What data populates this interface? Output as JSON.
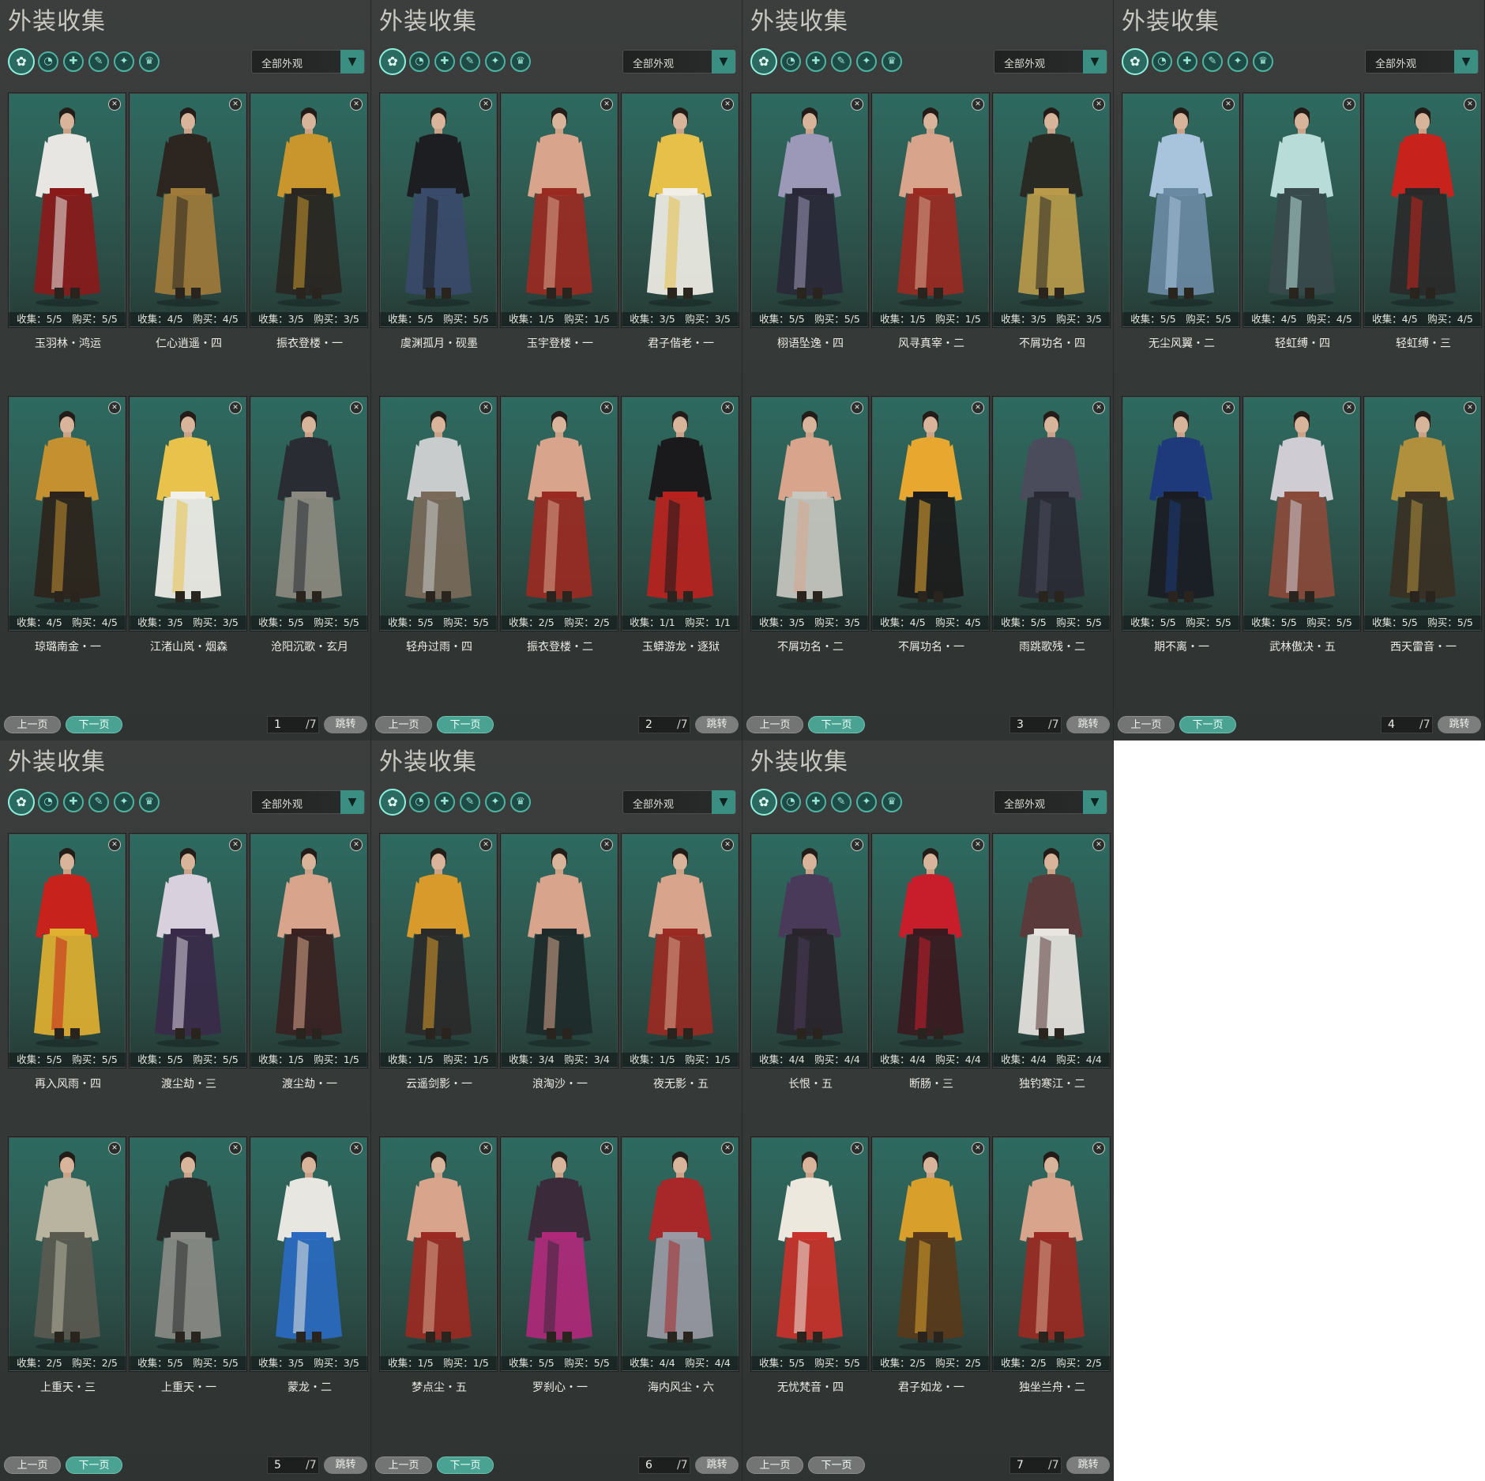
{
  "panel_title": "外装收集",
  "dropdown_label": "全部外观",
  "prev_label": "上一页",
  "next_label": "下一页",
  "jump_label": "跳转",
  "filter_icons": [
    "all-outfits-icon",
    "hair-icon",
    "top-icon",
    "dye-icon",
    "mask-icon",
    "hat-icon"
  ],
  "panels": [
    {
      "page": "1",
      "total": "/7",
      "items": [
        {
          "name": "玉羽林・鸿运",
          "stats": "收集：5/5　购买：5/5",
          "colors": [
            "#e8e6e2",
            "#8a1a1a"
          ]
        },
        {
          "name": "仁心逍遥・四",
          "stats": "收集：4/5　购买：4/5",
          "colors": [
            "#2d2620",
            "#a07a3a"
          ]
        },
        {
          "name": "振衣登楼・一",
          "stats": "收集：3/5　购买：3/5",
          "colors": [
            "#c8962c",
            "#2a2622"
          ]
        },
        {
          "name": "琼璐南金・一",
          "stats": "收集：4/5　购买：4/5",
          "colors": [
            "#c49030",
            "#2c241c"
          ]
        },
        {
          "name": "江渚山岚・烟森",
          "stats": "收集：3/5　购买：3/5",
          "colors": [
            "#e8c24a",
            "#f2f0ea"
          ]
        },
        {
          "name": "沧阳沉歌・玄月",
          "stats": "收集：5/5　购买：5/5",
          "colors": [
            "#2a2c34",
            "#8c8a80"
          ]
        }
      ]
    },
    {
      "page": "2",
      "total": "/7",
      "items": [
        {
          "name": "虞渊孤月・砚墨",
          "stats": "收集：5/5　购买：5/5",
          "colors": [
            "#1c1e22",
            "#3a4a6a"
          ]
        },
        {
          "name": "玉宇登楼・一",
          "stats": "收集：1/5　购买：1/5",
          "colors": [
            "#d8a58c",
            "#9a2a22"
          ]
        },
        {
          "name": "君子偕老・一",
          "stats": "收集：3/5　购买：3/5",
          "colors": [
            "#e6c048",
            "#f0eee6"
          ]
        },
        {
          "name": "轻舟过雨・四",
          "stats": "收集：5/5　购买：5/5",
          "colors": [
            "#c8cccc",
            "#7a6a5a"
          ]
        },
        {
          "name": "振衣登楼・二",
          "stats": "收集：2/5　购买：2/5",
          "colors": [
            "#d8a58c",
            "#9a2a22"
          ]
        },
        {
          "name": "玉蟒游龙・逐狱",
          "stats": "收集：1/1　购买：1/1",
          "colors": [
            "#1a1a1c",
            "#b8221e"
          ]
        }
      ]
    },
    {
      "page": "3",
      "total": "/7",
      "items": [
        {
          "name": "栩语坠逸・四",
          "stats": "收集：5/5　购买：5/5",
          "colors": [
            "#9c98b8",
            "#2a2838"
          ]
        },
        {
          "name": "风寻真宰・二",
          "stats": "收集：1/5　购买：1/5",
          "colors": [
            "#d8a58c",
            "#9a2a22"
          ]
        },
        {
          "name": "不屑功名・四",
          "stats": "收集：3/5　购买：3/5",
          "colors": [
            "#2a2a24",
            "#b89a4a"
          ]
        },
        {
          "name": "不屑功名・二",
          "stats": "收集：3/5　购买：3/5",
          "colors": [
            "#d8a58c",
            "#c8c8c0"
          ]
        },
        {
          "name": "不屑功名・一",
          "stats": "收集：4/5　购买：4/5",
          "colors": [
            "#e8a830",
            "#1c1c1c"
          ]
        },
        {
          "name": "雨跳歌残・二",
          "stats": "收集：5/5　购买：5/5",
          "colors": [
            "#4a4c5c",
            "#2a2a34"
          ]
        }
      ]
    },
    {
      "page": "4",
      "total": "/7",
      "items": [
        {
          "name": "无尘风翼・二",
          "stats": "收集：5/5　购买：5/5",
          "colors": [
            "#a8c4dc",
            "#6a8aa4"
          ]
        },
        {
          "name": "轻虹缚・四",
          "stats": "收集：4/5　购买：4/5",
          "colors": [
            "#b8dcd8",
            "#3a4a4c"
          ]
        },
        {
          "name": "轻虹缚・三",
          "stats": "收集：4/5　购买：4/5",
          "colors": [
            "#c8221c",
            "#2a2a2a"
          ]
        },
        {
          "name": "期不离・一",
          "stats": "收集：5/5　购买：5/5",
          "colors": [
            "#1e3a7a",
            "#1a1c24"
          ]
        },
        {
          "name": "武林傲决・五",
          "stats": "收集：5/5　购买：5/5",
          "colors": [
            "#d0ccd4",
            "#8a4a3a"
          ]
        },
        {
          "name": "西天雷音・一",
          "stats": "收集：5/5　购买：5/5",
          "colors": [
            "#b0903c",
            "#3a3024"
          ]
        }
      ]
    },
    {
      "page": "5",
      "total": "/7",
      "items": [
        {
          "name": "再入风雨・四",
          "stats": "收集：5/5　购买：5/5",
          "colors": [
            "#c8221c",
            "#e0b030"
          ]
        },
        {
          "name": "渡尘劫・三",
          "stats": "收集：5/5　购买：5/5",
          "colors": [
            "#d8d0dc",
            "#3a2a4a"
          ]
        },
        {
          "name": "渡尘劫・一",
          "stats": "收集：1/5　购买：1/5",
          "colors": [
            "#d8a58c",
            "#3a2222"
          ]
        },
        {
          "name": "上重天・三",
          "stats": "收集：2/5　购买：2/5",
          "colors": [
            "#b8b4a0",
            "#5a5a50"
          ]
        },
        {
          "name": "上重天・一",
          "stats": "收集：5/5　购买：5/5",
          "colors": [
            "#2a2c2c",
            "#8a8a84"
          ]
        },
        {
          "name": "蒙龙・二",
          "stats": "收集：3/5　购买：3/5",
          "colors": [
            "#e8e6e0",
            "#2a6ac0"
          ]
        }
      ]
    },
    {
      "page": "6",
      "total": "/7",
      "items": [
        {
          "name": "云遥剑影・一",
          "stats": "收集：1/5　购买：1/5",
          "colors": [
            "#d89a2a",
            "#2a2a2a"
          ]
        },
        {
          "name": "浪淘沙・一",
          "stats": "收集：3/4　购买：3/4",
          "colors": [
            "#d8a58c",
            "#1e2a2a"
          ]
        },
        {
          "name": "夜无影・五",
          "stats": "收集：1/5　购买：1/5",
          "colors": [
            "#d8a58c",
            "#9a2a22"
          ]
        },
        {
          "name": "梦点尘・五",
          "stats": "收集：1/5　购买：1/5",
          "colors": [
            "#d8a58c",
            "#9a2a22"
          ]
        },
        {
          "name": "罗刹心・一",
          "stats": "收集：5/5　购买：5/5",
          "colors": [
            "#3a2a3a",
            "#b0287a"
          ]
        },
        {
          "name": "海内风尘・六",
          "stats": "收集：4/4　购买：4/4",
          "colors": [
            "#a8282a",
            "#9a9aa4"
          ]
        }
      ]
    },
    {
      "page": "7",
      "total": "/7",
      "items": [
        {
          "name": "长恨・五",
          "stats": "收集：4/4　购买：4/4",
          "colors": [
            "#4a3a5a",
            "#2a242c"
          ]
        },
        {
          "name": "断肠・三",
          "stats": "收集：4/4　购买：4/4",
          "colors": [
            "#c81e2c",
            "#3a1a20"
          ]
        },
        {
          "name": "独钓寒江・二",
          "stats": "收集：4/4　购买：4/4",
          "colors": [
            "#5a3a3a",
            "#e8e4e0"
          ]
        },
        {
          "name": "无忧梵音・四",
          "stats": "收集：5/5　购买：5/5",
          "colors": [
            "#ece8de",
            "#c8322a"
          ]
        },
        {
          "name": "君子如龙・一",
          "stats": "收集：2/5　购买：2/5",
          "colors": [
            "#d8a02a",
            "#5a3a1a"
          ]
        },
        {
          "name": "独坐兰舟・二",
          "stats": "收集：2/5　购买：2/5",
          "colors": [
            "#d8a58c",
            "#9a2a22"
          ]
        }
      ]
    }
  ]
}
